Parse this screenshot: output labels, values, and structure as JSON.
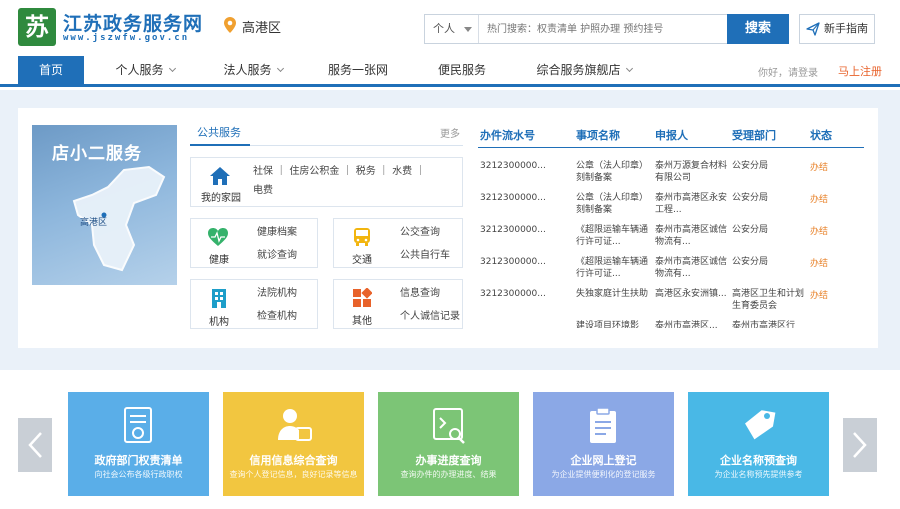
{
  "header": {
    "logo_mark": "苏",
    "site_title": "江苏政务服务网",
    "site_url": "www.jszwfw.gov.cn",
    "location": "高港区",
    "search": {
      "scope": "个人",
      "placeholder": "热门搜索：权责清单 护照办理 预约挂号",
      "button": "搜索"
    },
    "guide_button": "新手指南"
  },
  "nav": {
    "items": [
      {
        "label": "首页",
        "active": true
      },
      {
        "label": "个人服务",
        "dropdown": true
      },
      {
        "label": "法人服务",
        "dropdown": true
      },
      {
        "label": "服务一张网"
      },
      {
        "label": "便民服务"
      },
      {
        "label": "综合服务旗舰店",
        "dropdown": true
      }
    ],
    "greeting": "你好，请登录",
    "login": "马上注册"
  },
  "promo": {
    "title": "店小二服务",
    "map_label": "高港区"
  },
  "public_service": {
    "title": "公共服务",
    "more": "更多",
    "cards": [
      {
        "icon": "home-icon",
        "label": "我的家园",
        "lines": [
          "社保 ｜ 住房公积金 ｜ 税务 ｜ 水费 ｜",
          "电费"
        ]
      },
      {
        "icon": "health-icon",
        "label": "健康",
        "lines": [
          "健康档案",
          "就诊查询"
        ]
      },
      {
        "icon": "bus-icon",
        "label": "交通",
        "lines": [
          "公交查询",
          "公共自行车"
        ]
      },
      {
        "icon": "building-icon",
        "label": "机构",
        "lines": [
          "法院机构",
          "检查机构"
        ]
      },
      {
        "icon": "grid-icon",
        "label": "其他",
        "lines": [
          "信息查询",
          "个人诚信记录"
        ]
      }
    ]
  },
  "table": {
    "headers": [
      "办件流水号",
      "事项名称",
      "申报人",
      "受理部门",
      "状态"
    ],
    "rows": [
      {
        "id": "3212300000...",
        "item": "公章（法人印章）刻制备案",
        "applicant": "泰州万源复合材料有限公司",
        "dept": "公安分局",
        "status": "办结"
      },
      {
        "id": "3212300000...",
        "item": "公章（法人印章）刻制备案",
        "applicant": "泰州市高港区永安工程...",
        "dept": "公安分局",
        "status": "办结"
      },
      {
        "id": "3212300000...",
        "item": "《超限运输车辆通行许可证...",
        "applicant": "泰州市高港区诚信物流有...",
        "dept": "公安分局",
        "status": "办结"
      },
      {
        "id": "3212300000...",
        "item": "《超限运输车辆通行许可证...",
        "applicant": "泰州市高港区诚信物流有...",
        "dept": "公安分局",
        "status": "办结"
      },
      {
        "id": "3212300000...",
        "item": "失独家庭计生扶助",
        "applicant": "高港区永安洲镇...",
        "dept": "高港区卫生和计划生育委员会",
        "status": "办结"
      },
      {
        "id": "",
        "item": "建设项目环境影响...",
        "applicant": "泰州市高港区...",
        "dept": "泰州市高港区行政...",
        "status": ""
      }
    ]
  },
  "tiles": [
    {
      "name": "政府部门权责清单",
      "desc": "向社会公布各级行政职权",
      "color": "#5aaee8",
      "icon": "document-badge-icon"
    },
    {
      "name": "信用信息综合查询",
      "desc": "查询个人登记信息，良好记录等信息",
      "color": "#f2c640",
      "icon": "person-card-icon"
    },
    {
      "name": "办事进度查询",
      "desc": "查询办件的办理进度、结果",
      "color": "#7cc576",
      "icon": "search-doc-icon"
    },
    {
      "name": "企业网上登记",
      "desc": "为企业提供便利化的登记服务",
      "color": "#8ba8e6",
      "icon": "clipboard-icon"
    },
    {
      "name": "企业名称预查询",
      "desc": "为企业名称预先提供参考",
      "color": "#49b8e6",
      "icon": "tag-icon"
    }
  ]
}
